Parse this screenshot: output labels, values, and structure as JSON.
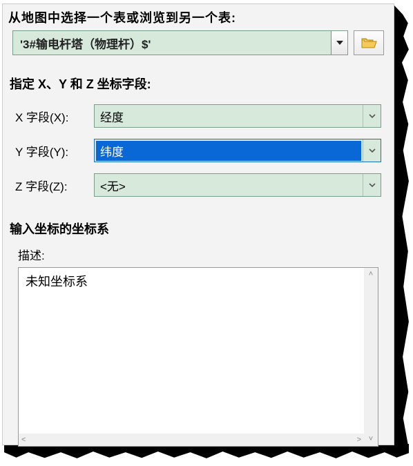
{
  "instruction": "从地图中选择一个表或浏览到另一个表:",
  "table_select": {
    "value": "'3#输电杆塔（物理杆）$'"
  },
  "coord_section_label": "指定 X、Y 和 Z 坐标字段:",
  "fields": {
    "x": {
      "label": "X 字段(X):",
      "value": "经度"
    },
    "y": {
      "label": "Y 字段(Y):",
      "value": "纬度"
    },
    "z": {
      "label": "Z 字段(Z):",
      "value": "<无>"
    }
  },
  "cs_section_label": "输入坐标的坐标系",
  "desc_label": "描述:",
  "desc_text": "未知坐标系"
}
